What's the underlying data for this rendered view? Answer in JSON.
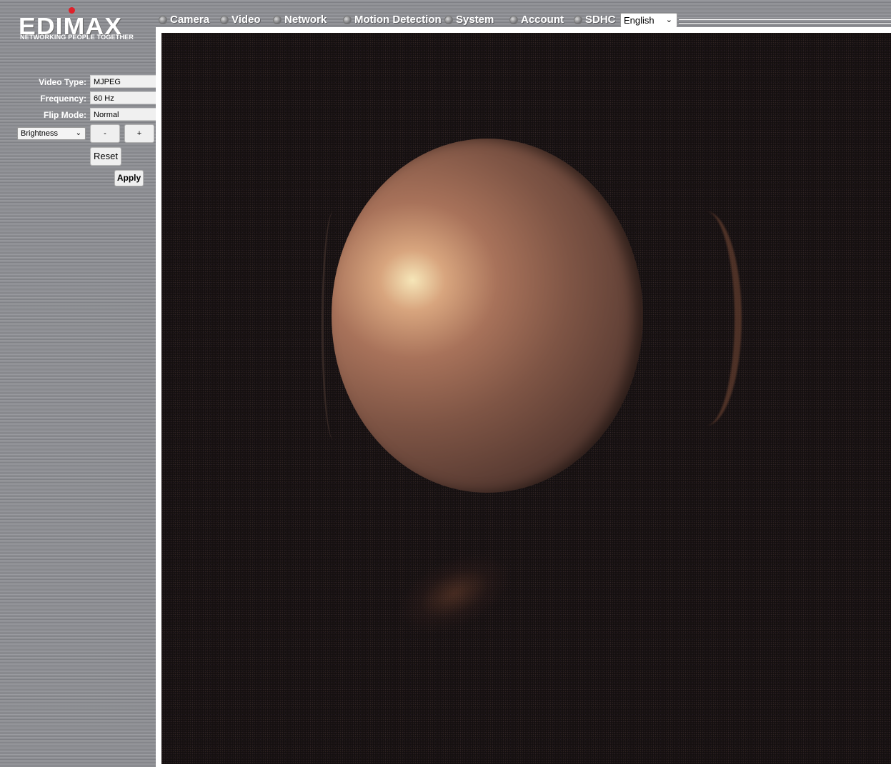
{
  "brand": {
    "name": "EDIMAX",
    "tagline": "NETWORKING PEOPLE TOGETHER"
  },
  "nav": {
    "items": [
      {
        "label": "Camera"
      },
      {
        "label": "Video"
      },
      {
        "label": "Network"
      },
      {
        "label": "Motion Detection"
      },
      {
        "label": "System"
      },
      {
        "label": "Account"
      },
      {
        "label": "SDHC"
      }
    ],
    "language": "English"
  },
  "settings": {
    "video_type_label": "Video Type:",
    "video_type_value": "MJPEG",
    "frequency_label": "Frequency:",
    "frequency_value": "60 Hz",
    "flip_mode_label": "Flip Mode:",
    "flip_mode_value": "Normal",
    "adjust_selected": "Brightness",
    "minus_label": "-",
    "plus_label": "+",
    "reset_label": "Reset",
    "apply_label": "Apply"
  },
  "colors": {
    "logo_dot": "#e0202a",
    "metal": "#8f9095",
    "video_bg": "#140f10"
  }
}
